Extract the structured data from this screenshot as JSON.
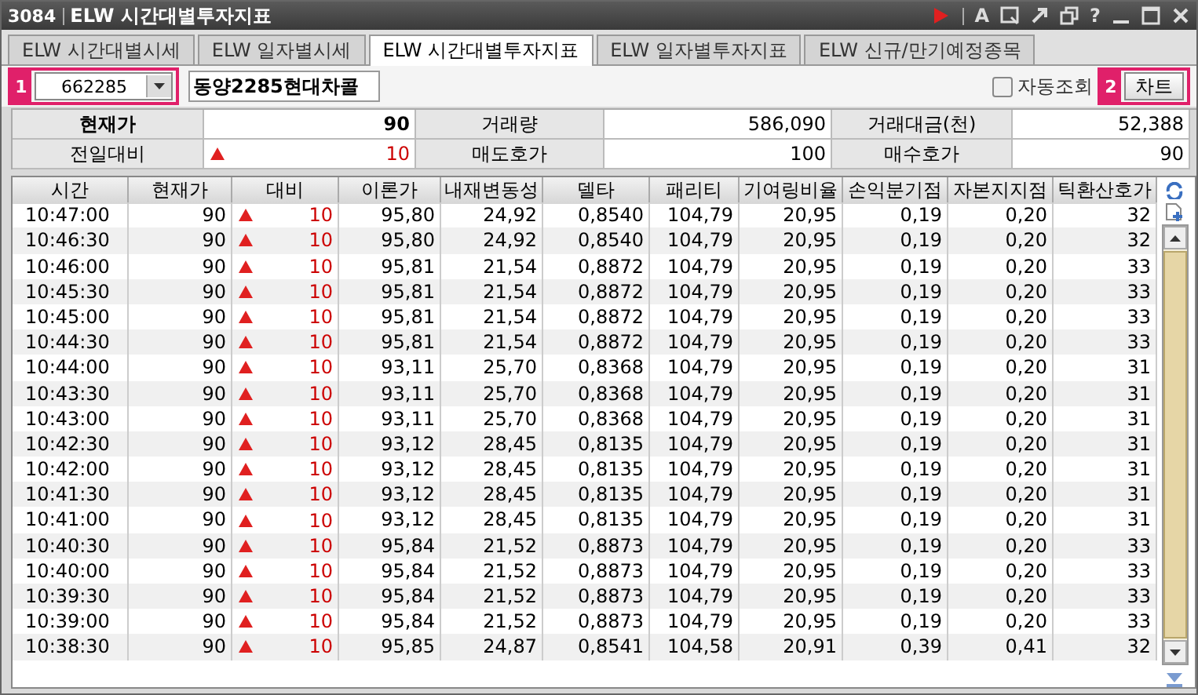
{
  "window": {
    "number": "3084",
    "title": "ELW 시간대별투자지표",
    "controls": [
      {
        "kind": "record"
      },
      {
        "kind": "font",
        "text": "A"
      },
      {
        "kind": "capture"
      },
      {
        "kind": "popout"
      },
      {
        "kind": "restore"
      },
      {
        "kind": "help",
        "text": "?"
      },
      {
        "kind": "minimize"
      },
      {
        "kind": "maximize"
      },
      {
        "kind": "close"
      }
    ]
  },
  "tabs": [
    {
      "label": "ELW 시간대별시세",
      "selected": false
    },
    {
      "label": "ELW 일자별시세",
      "selected": false
    },
    {
      "label": "ELW 시간대별투자지표",
      "selected": true
    },
    {
      "label": "ELW 일자별투자지표",
      "selected": false
    },
    {
      "label": "ELW 신규/만기예정종목",
      "selected": false
    }
  ],
  "toolbar": {
    "callout_1": "1",
    "code": "662285",
    "name": "동양2285현대차콜",
    "auto_query": {
      "label": "자동조회",
      "checked": false
    },
    "callout_2": "2",
    "chart_button": "차트"
  },
  "summary": [
    {
      "label": "현재가",
      "value": "90",
      "kind": "plain"
    },
    {
      "label": "거래량",
      "value": "586,090",
      "kind": "plain"
    },
    {
      "label": "거래대금(천)",
      "value": "52,388",
      "kind": "plain"
    },
    {
      "label": "전일대비",
      "value": "10",
      "kind": "up"
    },
    {
      "label": "매도호가",
      "value": "100",
      "kind": "plain"
    },
    {
      "label": "매수호가",
      "value": "90",
      "kind": "plain"
    }
  ],
  "table": {
    "columns": [
      "시간",
      "현재가",
      "대비",
      "이론가",
      "내재변동성",
      "델타",
      "패리티",
      "기여링비율",
      "손익분기점",
      "자본지지점",
      "틱환산호가"
    ],
    "rows": [
      {
        "kind": "up",
        "cells": [
          "10:47:00",
          "90",
          "10",
          "95,80",
          "24,92",
          "0,8540",
          "104,79",
          "20,95",
          "0,19",
          "0,20",
          "32"
        ]
      },
      {
        "kind": "up",
        "cells": [
          "10:46:30",
          "90",
          "10",
          "95,80",
          "24,92",
          "0,8540",
          "104,79",
          "20,95",
          "0,19",
          "0,20",
          "32"
        ]
      },
      {
        "kind": "up",
        "cells": [
          "10:46:00",
          "90",
          "10",
          "95,81",
          "21,54",
          "0,8872",
          "104,79",
          "20,95",
          "0,19",
          "0,20",
          "33"
        ]
      },
      {
        "kind": "up",
        "cells": [
          "10:45:30",
          "90",
          "10",
          "95,81",
          "21,54",
          "0,8872",
          "104,79",
          "20,95",
          "0,19",
          "0,20",
          "33"
        ]
      },
      {
        "kind": "up",
        "cells": [
          "10:45:00",
          "90",
          "10",
          "95,81",
          "21,54",
          "0,8872",
          "104,79",
          "20,95",
          "0,19",
          "0,20",
          "33"
        ]
      },
      {
        "kind": "up",
        "cells": [
          "10:44:30",
          "90",
          "10",
          "95,81",
          "21,54",
          "0,8872",
          "104,79",
          "20,95",
          "0,19",
          "0,20",
          "33"
        ]
      },
      {
        "kind": "up",
        "cells": [
          "10:44:00",
          "90",
          "10",
          "93,11",
          "25,70",
          "0,8368",
          "104,79",
          "20,95",
          "0,19",
          "0,20",
          "31"
        ]
      },
      {
        "kind": "up",
        "cells": [
          "10:43:30",
          "90",
          "10",
          "93,11",
          "25,70",
          "0,8368",
          "104,79",
          "20,95",
          "0,19",
          "0,20",
          "31"
        ]
      },
      {
        "kind": "up",
        "cells": [
          "10:43:00",
          "90",
          "10",
          "93,11",
          "25,70",
          "0,8368",
          "104,79",
          "20,95",
          "0,19",
          "0,20",
          "31"
        ]
      },
      {
        "kind": "up",
        "cells": [
          "10:42:30",
          "90",
          "10",
          "93,12",
          "28,45",
          "0,8135",
          "104,79",
          "20,95",
          "0,19",
          "0,20",
          "31"
        ]
      },
      {
        "kind": "up",
        "cells": [
          "10:42:00",
          "90",
          "10",
          "93,12",
          "28,45",
          "0,8135",
          "104,79",
          "20,95",
          "0,19",
          "0,20",
          "31"
        ]
      },
      {
        "kind": "up",
        "cells": [
          "10:41:30",
          "90",
          "10",
          "93,12",
          "28,45",
          "0,8135",
          "104,79",
          "20,95",
          "0,19",
          "0,20",
          "31"
        ]
      },
      {
        "kind": "up",
        "cells": [
          "10:41:00",
          "90",
          "10",
          "93,12",
          "28,45",
          "0,8135",
          "104,79",
          "20,95",
          "0,19",
          "0,20",
          "31"
        ]
      },
      {
        "kind": "up",
        "cells": [
          "10:40:30",
          "90",
          "10",
          "95,84",
          "21,52",
          "0,8873",
          "104,79",
          "20,95",
          "0,19",
          "0,20",
          "33"
        ]
      },
      {
        "kind": "up",
        "cells": [
          "10:40:00",
          "90",
          "10",
          "95,84",
          "21,52",
          "0,8873",
          "104,79",
          "20,95",
          "0,19",
          "0,20",
          "33"
        ]
      },
      {
        "kind": "up",
        "cells": [
          "10:39:30",
          "90",
          "10",
          "95,84",
          "21,52",
          "0,8873",
          "104,79",
          "20,95",
          "0,19",
          "0,20",
          "33"
        ]
      },
      {
        "kind": "up",
        "cells": [
          "10:39:00",
          "90",
          "10",
          "95,84",
          "21,52",
          "0,8873",
          "104,79",
          "20,95",
          "0,19",
          "0,20",
          "33"
        ]
      },
      {
        "kind": "up",
        "cells": [
          "10:38:30",
          "90",
          "10",
          "95,85",
          "24,87",
          "0,8541",
          "104,58",
          "20,91",
          "0,39",
          "0,41",
          "32"
        ]
      }
    ]
  }
}
